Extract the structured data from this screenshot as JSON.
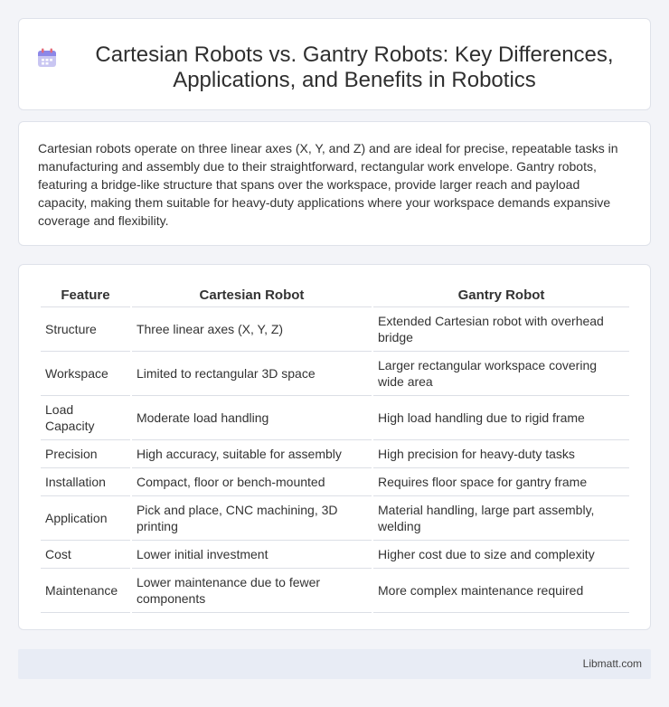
{
  "header": {
    "title": "Cartesian Robots vs. Gantry Robots: Key Differences, Applications, and Benefits in Robotics",
    "icon": "calendar-icon"
  },
  "intro": {
    "text": "Cartesian robots operate on three linear axes (X, Y, and Z) and are ideal for precise, repeatable tasks in manufacturing and assembly due to their straightforward, rectangular work envelope. Gantry robots, featuring a bridge-like structure that spans over the workspace, provide larger reach and payload capacity, making them suitable for heavy-duty applications where your workspace demands expansive coverage and flexibility."
  },
  "table": {
    "headers": [
      "Feature",
      "Cartesian Robot",
      "Gantry Robot"
    ],
    "rows": [
      [
        "Structure",
        "Three linear axes (X, Y, Z)",
        "Extended Cartesian robot with overhead bridge"
      ],
      [
        "Workspace",
        "Limited to rectangular 3D space",
        "Larger rectangular workspace covering wide area"
      ],
      [
        "Load Capacity",
        "Moderate load handling",
        "High load handling due to rigid frame"
      ],
      [
        "Precision",
        "High accuracy, suitable for assembly",
        "High precision for heavy-duty tasks"
      ],
      [
        "Installation",
        "Compact, floor or bench-mounted",
        "Requires floor space for gantry frame"
      ],
      [
        "Application",
        "Pick and place, CNC machining, 3D printing",
        "Material handling, large part assembly, welding"
      ],
      [
        "Cost",
        "Lower initial investment",
        "Higher cost due to size and complexity"
      ],
      [
        "Maintenance",
        "Lower maintenance due to fewer components",
        "More complex maintenance required"
      ]
    ]
  },
  "footer": {
    "site": "Libmatt.com"
  }
}
